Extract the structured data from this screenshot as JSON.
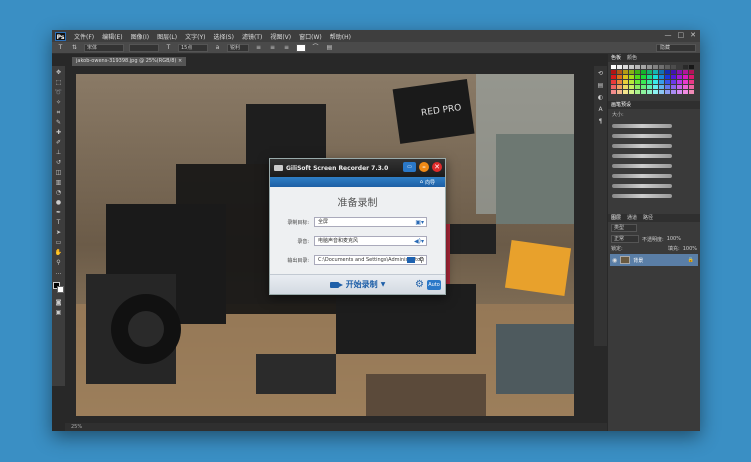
{
  "menubar": {
    "logo": "Ps",
    "items": [
      "文件(F)",
      "编辑(E)",
      "图像(I)",
      "图层(L)",
      "文字(Y)",
      "选择(S)",
      "滤镜(T)",
      "视图(V)",
      "窗口(W)",
      "帮助(H)"
    ],
    "controls": [
      "—",
      "□",
      "✕"
    ]
  },
  "options": {
    "font_family": "宋体",
    "font_size": "15点",
    "aa_label": "锐利",
    "workspace": "隐藏"
  },
  "document": {
    "tab_label": "jakob-owens-319398.jpg @ 25%(RGB/8) ×"
  },
  "panels": {
    "color_tabs": [
      "色板",
      "颜色"
    ],
    "brush_tabs": [
      "画笔预设"
    ],
    "brush_label": "大小:",
    "layer_tabs": [
      "图层",
      "通道",
      "路径"
    ],
    "layer_kind": "类型",
    "layer_mode": "正常",
    "opacity_label": "不透明度:",
    "opacity_value": "100%",
    "lock_label": "锁定:",
    "fill_label": "填充:",
    "fill_value": "100%",
    "layer_name": "背景"
  },
  "recorder": {
    "title": "GiliSoft Screen Recorder 7.3.0",
    "nav_label": "向导",
    "heading": "准备录制",
    "rows": [
      {
        "label": "录制目标:",
        "value": "全屏"
      },
      {
        "label": "录音:",
        "value": "电脑声音和麦克风"
      },
      {
        "label": "输出目录:",
        "value": "C:\\Documents and Settings\\Administrator\\"
      }
    ],
    "start_label": "开始录制",
    "auto_label": "Auto"
  },
  "colors": {
    "accent_blue": "#2a78c8",
    "close_red": "#e02b2b",
    "min_orange": "#f08a16",
    "background": "#3a8fc4"
  }
}
